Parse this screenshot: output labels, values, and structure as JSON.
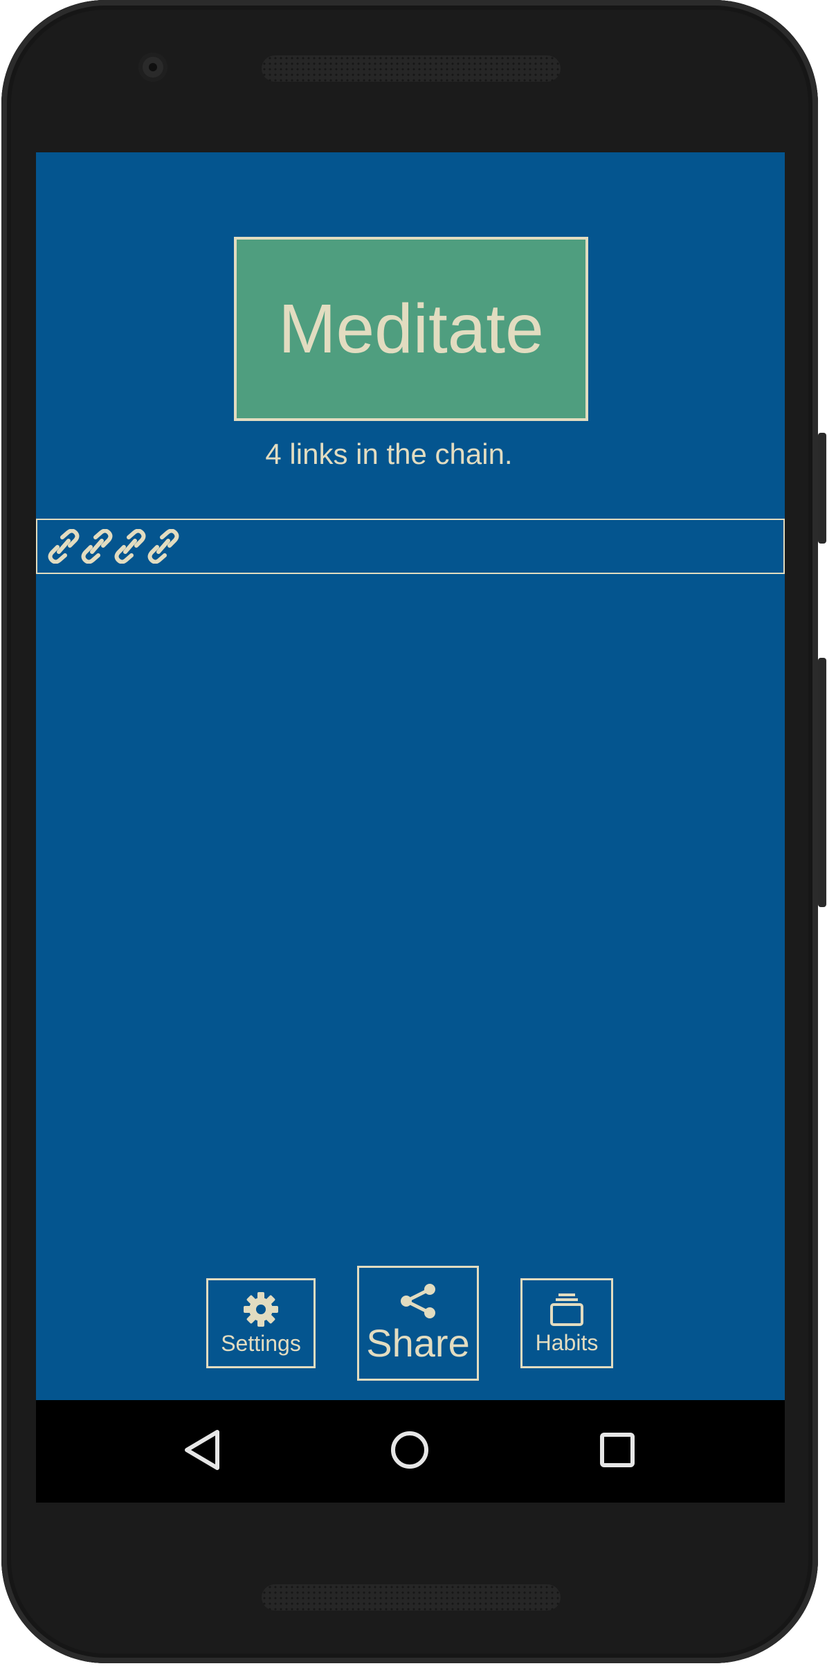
{
  "habit": {
    "name": "Meditate",
    "chain_text": "4 links in the chain.",
    "link_count": 4
  },
  "toolbar": {
    "settings_label": "Settings",
    "share_label": "Share",
    "habits_label": "Habits"
  },
  "icons": {
    "link": "link-icon",
    "settings": "gear-icon",
    "share": "share-icon",
    "habits": "stack-icon",
    "nav_back": "back-triangle-icon",
    "nav_home": "home-circle-icon",
    "nav_recent": "recent-square-icon"
  },
  "colors": {
    "background": "#04558f",
    "habit_button": "#4f9e7f",
    "foreground": "#e2dcc0",
    "nav_bar": "#000000"
  }
}
